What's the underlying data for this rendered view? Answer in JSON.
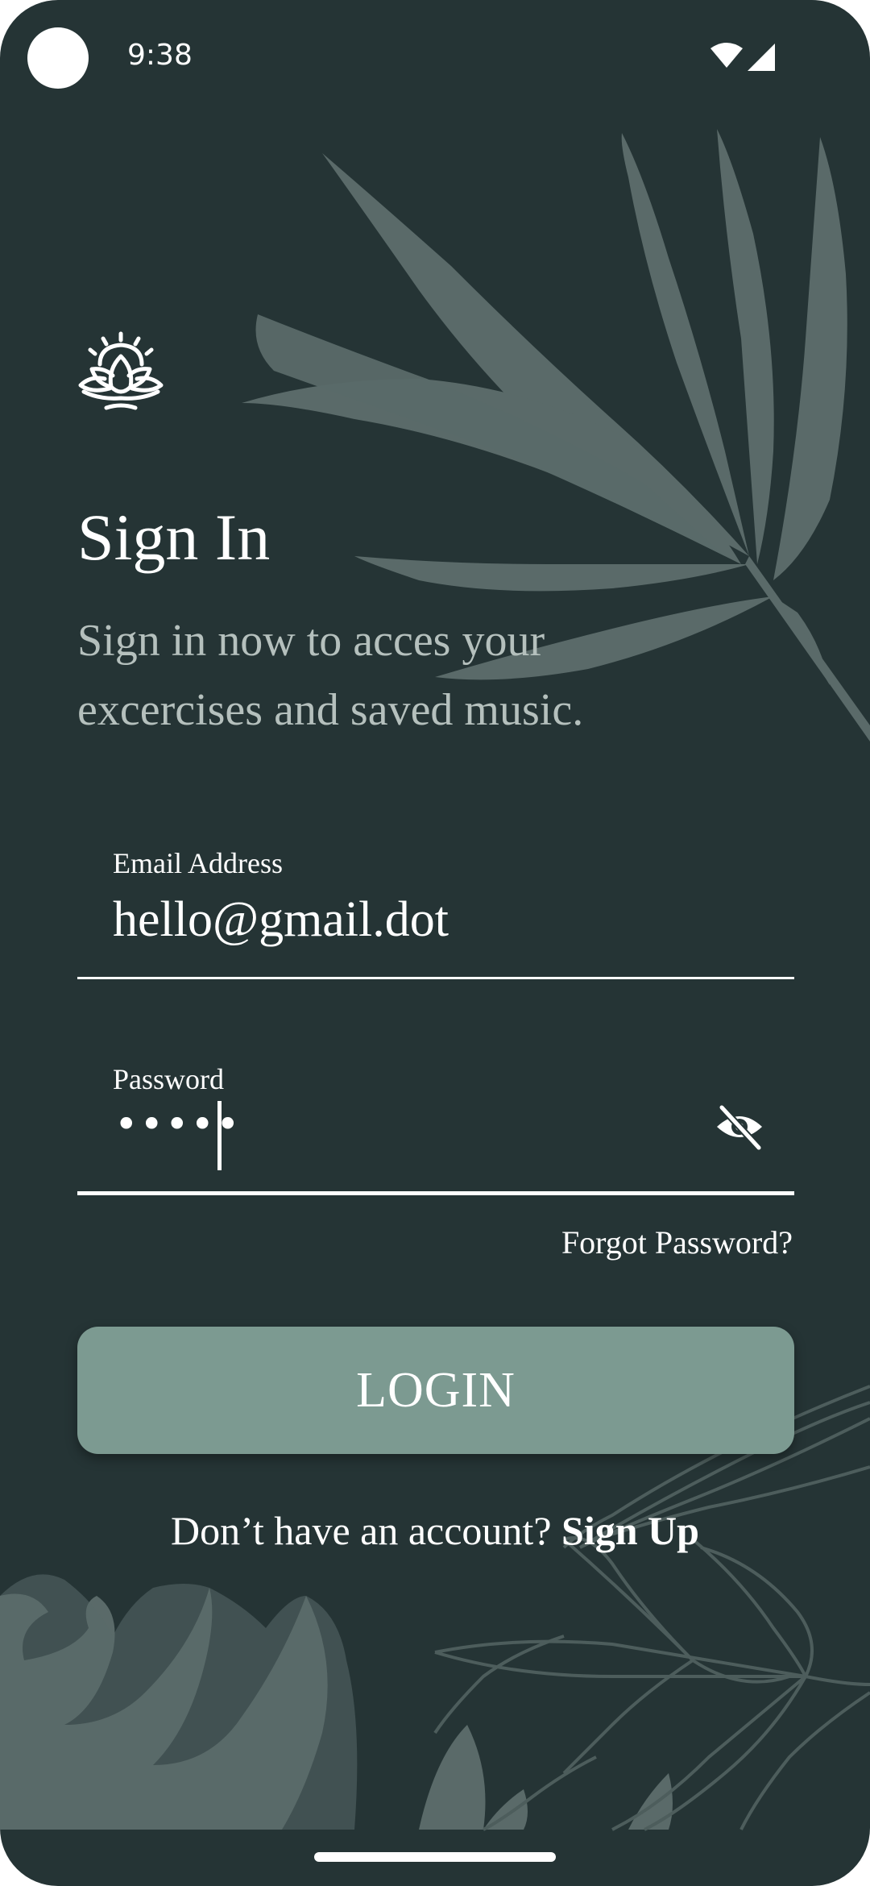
{
  "status_bar": {
    "time": "9:38"
  },
  "header": {
    "title": "Sign In",
    "subtitle_line1": "Sign in now to acces your",
    "subtitle_line2": "excercises and saved music."
  },
  "form": {
    "email": {
      "label": "Email Address",
      "value": "hello@gmail.dot"
    },
    "password": {
      "label": "Password",
      "masked_value": "•••••"
    },
    "forgot_label": "Forgot Password?",
    "login_label": "LOGIN"
  },
  "footer": {
    "prompt": "Don’t have an account?",
    "signup_label": "Sign Up"
  },
  "icons": {
    "logo": "lotus-sun-icon",
    "visibility": "eye-off-icon",
    "wifi": "wifi-icon",
    "signal": "cellular-signal-icon"
  },
  "colors": {
    "background": "#253435",
    "accent_button": "#7c9a91",
    "leaf": "#5a6a69",
    "text_primary": "#ffffff",
    "text_secondary": "#b5c0bd"
  }
}
